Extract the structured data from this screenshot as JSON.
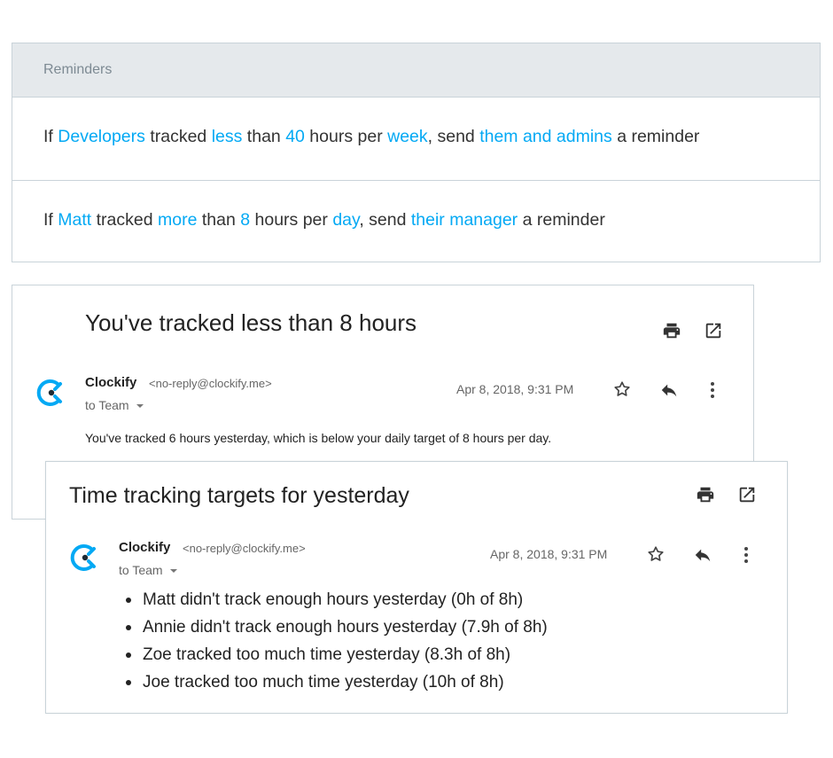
{
  "reminders": {
    "header": "Reminders",
    "rule1": {
      "if": "If ",
      "who": "Developers",
      "tracked": " tracked ",
      "cmp": "less",
      "than": " than ",
      "amount": "40",
      "per": " hours per ",
      "period": "week",
      "send": ", send ",
      "recipients": "them and admins",
      "tail": " a reminder"
    },
    "rule2": {
      "if": "If ",
      "who": "Matt",
      "tracked": " tracked ",
      "cmp": "more",
      "than": " than ",
      "amount": "8",
      "per": " hours per ",
      "period": "day",
      "send": ", send ",
      "recipients": "their manager",
      "tail": " a reminder"
    }
  },
  "email1": {
    "subject": "You've tracked less than 8 hours",
    "sender_name": "Clockify",
    "sender_email": "<no-reply@clockify.me>",
    "to": "to Team",
    "date": "Apr 8, 2018, 9:31 PM",
    "body": "You've tracked 6 hours yesterday, which is below your daily target of 8 hours per day."
  },
  "email2": {
    "subject": "Time tracking targets for yesterday",
    "sender_name": "Clockify",
    "sender_email": "<no-reply@clockify.me>",
    "to": "to Team",
    "date": "Apr 8, 2018, 9:31 PM",
    "items": [
      "Matt didn't track enough hours yesterday (0h of 8h)",
      "Annie didn't track enough hours yesterday (7.9h of 8h)",
      "Zoe tracked too much time yesterday (8.3h of 8h)",
      "Joe tracked too much time yesterday (10h of 8h)"
    ]
  },
  "colors": {
    "accent": "#03a9f4",
    "border": "#c9d3d9",
    "header_bg": "#e5e9ec"
  },
  "icons": [
    "clockify-logo-icon",
    "print-icon",
    "open-new-window-icon",
    "star-icon",
    "reply-icon",
    "more-vert-icon",
    "dropdown-caret-icon"
  ]
}
